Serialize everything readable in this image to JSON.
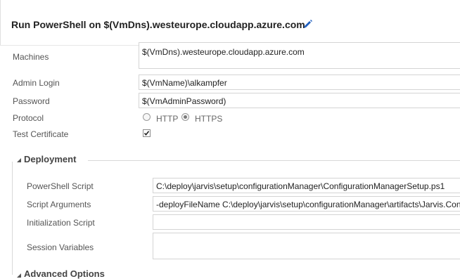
{
  "task": {
    "title": "Run PowerShell on $(VmDns).westeurope.cloudapp.azure.com"
  },
  "form": {
    "machines": {
      "label": "Machines",
      "value": "$(VmDns).westeurope.cloudapp.azure.com"
    },
    "admin_login": {
      "label": "Admin Login",
      "value": "$(VmName)\\alkampfer"
    },
    "password": {
      "label": "Password",
      "value": "$(VmAdminPassword)"
    },
    "protocol": {
      "label": "Protocol",
      "options": [
        "HTTP",
        "HTTPS"
      ],
      "selected": "HTTPS"
    },
    "test_certificate": {
      "label": "Test Certificate",
      "checked": true
    }
  },
  "deployment": {
    "title": "Deployment",
    "powershell_script": {
      "label": "PowerShell Script",
      "value": "C:\\deploy\\jarvis\\setup\\configurationManager\\ConfigurationManagerSetup.ps1"
    },
    "script_arguments": {
      "label": "Script Arguments",
      "value": "-deployFileName C:\\deploy\\jarvis\\setup\\configurationManager\\artifacts\\Jarvis.Con"
    },
    "initialization_script": {
      "label": "Initialization Script",
      "value": ""
    },
    "session_variables": {
      "label": "Session Variables",
      "value": ""
    }
  },
  "advanced": {
    "title": "Advanced Options"
  },
  "colors": {
    "edit_icon": "#1f5fbf"
  }
}
